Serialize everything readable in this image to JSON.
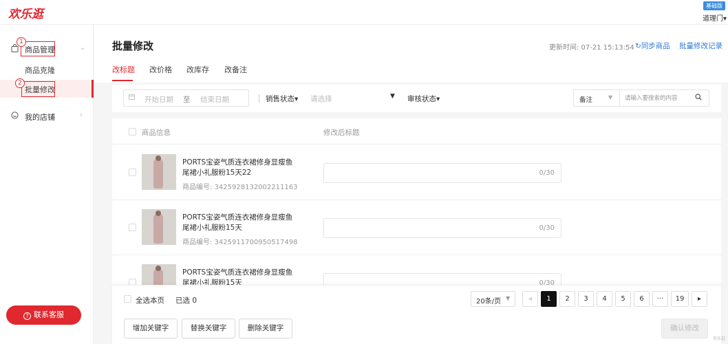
{
  "app": {
    "logo": "欢乐逛",
    "edition_badge": "基础版",
    "user_name": "道理门▾"
  },
  "sidebar": {
    "groups": [
      {
        "label": "商品管理",
        "expanded": true,
        "children": [
          {
            "label": "商品克隆",
            "active": false
          },
          {
            "label": "批量修改",
            "active": true
          }
        ]
      },
      {
        "label": "我的店铺",
        "expanded": false,
        "children": []
      }
    ],
    "annotations": [
      "1",
      "2"
    ],
    "service_button": "联系客服",
    "service_icon": "?"
  },
  "header": {
    "title": "批量修改",
    "update_time": "更新时间: 07-21 15:13:54",
    "sync_button": "同步商品",
    "sync_icon": "↻",
    "log_link": "批量修改记录"
  },
  "tabs": [
    {
      "label": "改标题",
      "active": true
    },
    {
      "label": "改价格",
      "active": false
    },
    {
      "label": "改库存",
      "active": false
    },
    {
      "label": "改备注",
      "active": false
    }
  ],
  "filters": {
    "start_date_placeholder": "开始日期",
    "date_separator": "至",
    "end_date_placeholder": "结束日期",
    "sale_status_label": "销售状态▾",
    "sale_status_placeholder": "请选择",
    "caret": "▼",
    "audit_status_label": "审核状态▾",
    "search_type": "备注",
    "search_type_caret": "▼",
    "search_placeholder": "请输入要搜索的内容"
  },
  "table": {
    "headers": {
      "product_info": "商品信息",
      "new_title": "修改后标题"
    },
    "code_label": "商品编号: ",
    "rows": [
      {
        "title": "PORTS宝姿气质连衣裙修身显瘦鱼尾裙小礼服粉15天22",
        "code": "3425928132002211163",
        "counter": "0/30"
      },
      {
        "title": "PORTS宝姿气质连衣裙修身显瘦鱼尾裙小礼服粉15天",
        "code": "3425911700950517498",
        "counter": "0/30"
      },
      {
        "title": "PORTS宝姿气质连衣裙修身显瘦鱼尾裙小礼服粉15天",
        "code": "",
        "counter": "0/30"
      }
    ]
  },
  "footer": {
    "select_all": "全选本页",
    "selected_count": "已选 0",
    "page_size": "20条/页",
    "page_size_caret": "▼",
    "prev": "◂",
    "next": "▸",
    "pages": [
      "1",
      "2",
      "3",
      "4",
      "5",
      "6",
      "···",
      "19"
    ],
    "current_page": "1",
    "add_keyword": "增加关键字",
    "replace_keyword": "替换关键字",
    "delete_keyword": "删除关键字",
    "confirm": "确认修改",
    "watermark": "欢乐逛"
  },
  "colors": {
    "brand_red": "#e0282e",
    "link_blue": "#2d7ad6",
    "badge_blue": "#3b8de0"
  }
}
